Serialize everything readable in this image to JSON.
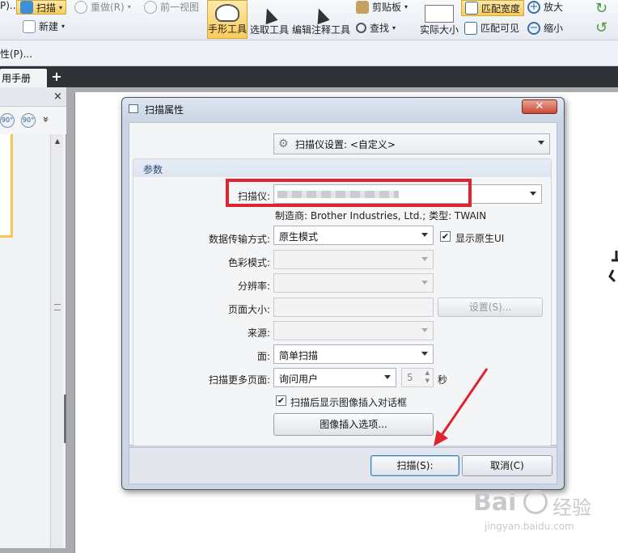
{
  "ribbon": {
    "scan_label": "扫描",
    "new_label": "新建",
    "redo_label": "重做(R)",
    "prev_view_label": "前一视图",
    "hand_tool_label": "手形工具",
    "select_tool_label": "选取工具",
    "edit_annot_label": "编辑注释工具",
    "clipboard_label": "剪贴板",
    "find_label": "查找",
    "actual_size_label": "实际大小",
    "fit_width_label": "匹配宽度",
    "fit_visible_label": "匹配可见",
    "zoom_in_label": "放大",
    "zoom_out_label": "缩小",
    "left_trunc": "P)..."
  },
  "menu": {
    "properties_label": "性(P)..."
  },
  "tabs": {
    "doc_tab_label": "用手册",
    "add_tab": "+"
  },
  "left_panel": {
    "close": "×",
    "rotate_left": "90°",
    "rotate_right": "90°",
    "more": "»"
  },
  "dialog": {
    "title": "扫描属性",
    "close": "✕",
    "preset_label": "扫描仪设置: <自定义>",
    "group_title": "参数",
    "scanner_label": "扫描仪:",
    "scanner_value": "",
    "manufacturer_text": "制造商: Brother Industries, Ltd.; 类型: TWAIN",
    "transfer_label": "数据传输方式:",
    "transfer_value": "原生模式",
    "show_native_ui_label": "显示原生UI",
    "color_mode_label": "色彩模式:",
    "resolution_label": "分辨率:",
    "page_size_label": "页面大小:",
    "settings_button": "设置(S)...",
    "source_label": "来源:",
    "side_label": "面:",
    "side_value": "简单扫描",
    "more_pages_label": "扫描更多页面:",
    "more_pages_value": "询问用户",
    "seconds_value": "5",
    "seconds_unit": "秒",
    "show_insert_dialog_label": "扫描后显示图像插入对话框",
    "insert_options_button": "图像插入选项...",
    "scan_button": "扫描(S):",
    "cancel_button": "取消(C)"
  },
  "watermark": {
    "brand": "Bai",
    "brand_cn": "经验",
    "url": "jingyan.baidu.com"
  },
  "colors": {
    "highlight": "#e0242f",
    "accent_ribbon": "#f8cc5c"
  }
}
